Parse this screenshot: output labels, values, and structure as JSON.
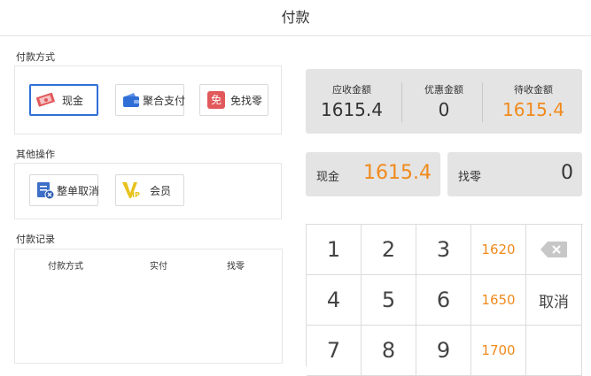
{
  "header": {
    "title": "付款"
  },
  "payment_methods": {
    "label": "付款方式",
    "items": [
      {
        "label": "现金",
        "icon": "cash-icon",
        "active": true
      },
      {
        "label": "聚合支付",
        "icon": "wallet-icon",
        "active": false
      },
      {
        "label": "免找零",
        "icon": "no-change-icon",
        "icon_text": "免",
        "active": false
      }
    ]
  },
  "other_ops": {
    "label": "其他操作",
    "items": [
      {
        "label": "整单取消",
        "icon": "cancel-order-icon"
      },
      {
        "label": "会员",
        "icon": "vip-icon",
        "icon_text": "IP"
      }
    ]
  },
  "records": {
    "label": "付款记录",
    "columns": [
      "付款方式",
      "实付",
      "找零"
    ]
  },
  "summary": {
    "receivable_label": "应收金额",
    "receivable_value": "1615.4",
    "discount_label": "优惠金额",
    "discount_value": "0",
    "pending_label": "待收金额",
    "pending_value": "1615.4"
  },
  "cash": {
    "label": "现金",
    "value": "1615.4"
  },
  "change": {
    "label": "找零",
    "value": "0"
  },
  "keypad": {
    "keys": [
      "1",
      "2",
      "3",
      "1620",
      "",
      "4",
      "5",
      "6",
      "1650",
      "取消",
      "7",
      "8",
      "9",
      "1700",
      ""
    ],
    "backspace_icon": "backspace-icon"
  },
  "colors": {
    "accent_orange": "#f08a1c",
    "active_blue": "#2f6fd6",
    "panel_grey": "#e4e4e4"
  }
}
